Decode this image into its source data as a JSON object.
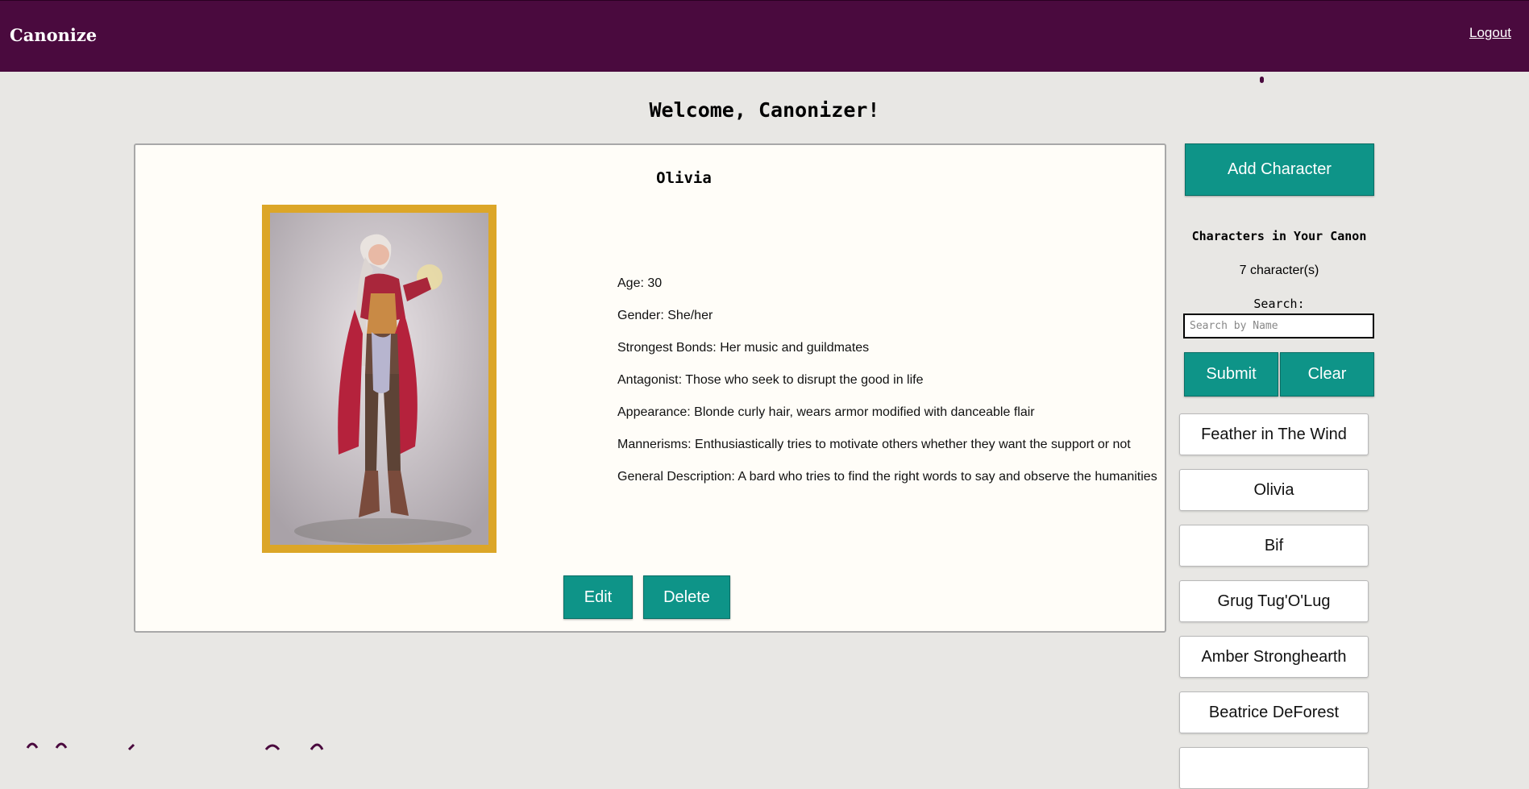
{
  "nav": {
    "brand": "Canonize",
    "logout_label": "Logout"
  },
  "welcome": "Welcome, Canonizer!",
  "character": {
    "name": "Olivia",
    "details": [
      "Age: 30",
      "Gender: She/her",
      "Strongest Bonds: Her music and guildmates",
      "Antagonist: Those who seek to disrupt the good in life",
      "Appearance: Blonde curly hair, wears armor modified with danceable flair",
      "Mannerisms: Enthusiastically tries to motivate others whether they want the support or not",
      "General Description: A bard who tries to find the right words to say and observe the humanities"
    ],
    "edit_label": "Edit",
    "delete_label": "Delete"
  },
  "sidebar": {
    "add_label": "Add Character",
    "heading": "Characters in Your Canon",
    "count": "7 character(s)",
    "search_label": "Search:",
    "search_placeholder": "Search by Name",
    "submit_label": "Submit",
    "clear_label": "Clear",
    "characters": [
      "Feather in The Wind",
      "Olivia",
      "Bif",
      "Grug Tug'O'Lug",
      "Amber Stronghearth",
      "Beatrice DeForest"
    ]
  },
  "colors": {
    "header": "#4a0a3e",
    "accent": "#0e9488",
    "frame": "#dca628",
    "background": "#e8e7e4"
  }
}
